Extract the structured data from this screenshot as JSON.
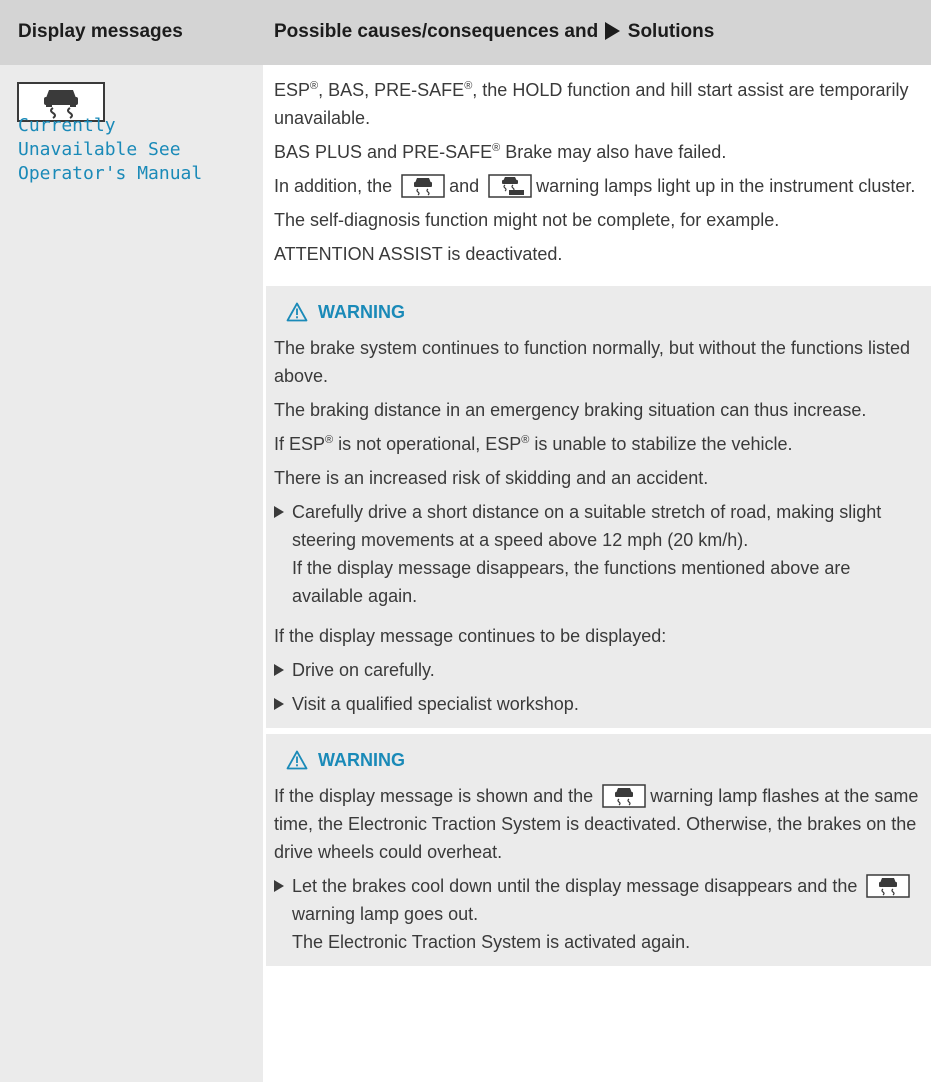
{
  "header": {
    "col1": "Display messages",
    "col2_before": "Possible causes/consequences and",
    "col2_after": "Solutions"
  },
  "display_message": {
    "icon": "esp-skid-icon",
    "text": "Currently\nUnavailable See\nOperator's Manual"
  },
  "intro": {
    "l1_p1": "ESP",
    "l1_p2": ", BAS, PRE-SAFE",
    "l1_p3": ", the HOLD function and hill start assist are temporarily unavailable.",
    "l2_p1": "BAS PLUS and PRE-SAFE",
    "l2_p2": " Brake may also have failed.",
    "l3_p1": "In addition, the",
    "l3_p2": "and",
    "l3_p3": "warning lamps light up in the instrument cluster.",
    "l4": "The self-diagnosis function might not be complete, for example.",
    "l5": "ATTENTION ASSIST is deactivated."
  },
  "reg": "®",
  "warning1": {
    "title": "WARNING",
    "p1": "The brake system continues to function normally, but without the functions listed above.",
    "p2": "The braking distance in an emergency braking situation can thus increase.",
    "p3_a": "If ESP",
    "p3_b": " is not operational, ESP",
    "p3_c": " is unable to stabilize the vehicle.",
    "p4": "There is an increased risk of skidding and an accident.",
    "step1": "Carefully drive a short distance on a suitable stretch of road, making slight steering movements at a speed above 12 mph (20 km/h).",
    "step1_result": "If the display message disappears, the functions mentioned above are available again.",
    "p5": "If the display message continues to be displayed:",
    "step2": "Drive on carefully.",
    "step3": "Visit a qualified specialist workshop."
  },
  "warning2": {
    "title": "WARNING",
    "p1_a": "If the display message is shown and the",
    "p1_b": "warning lamp flashes at the same time, the Electronic Traction System is deactivated. Otherwise, the brakes on the drive wheels could overheat.",
    "step1_a": "Let the brakes cool down until the display message disappears and the",
    "step1_b": "warning lamp goes out.",
    "step1_result": "The Electronic Traction System is activated again."
  },
  "colors": {
    "header_bg": "#d4d4d4",
    "left_bg": "#ebebeb",
    "accent": "#1a8ab8",
    "text": "#3a3a3a"
  }
}
